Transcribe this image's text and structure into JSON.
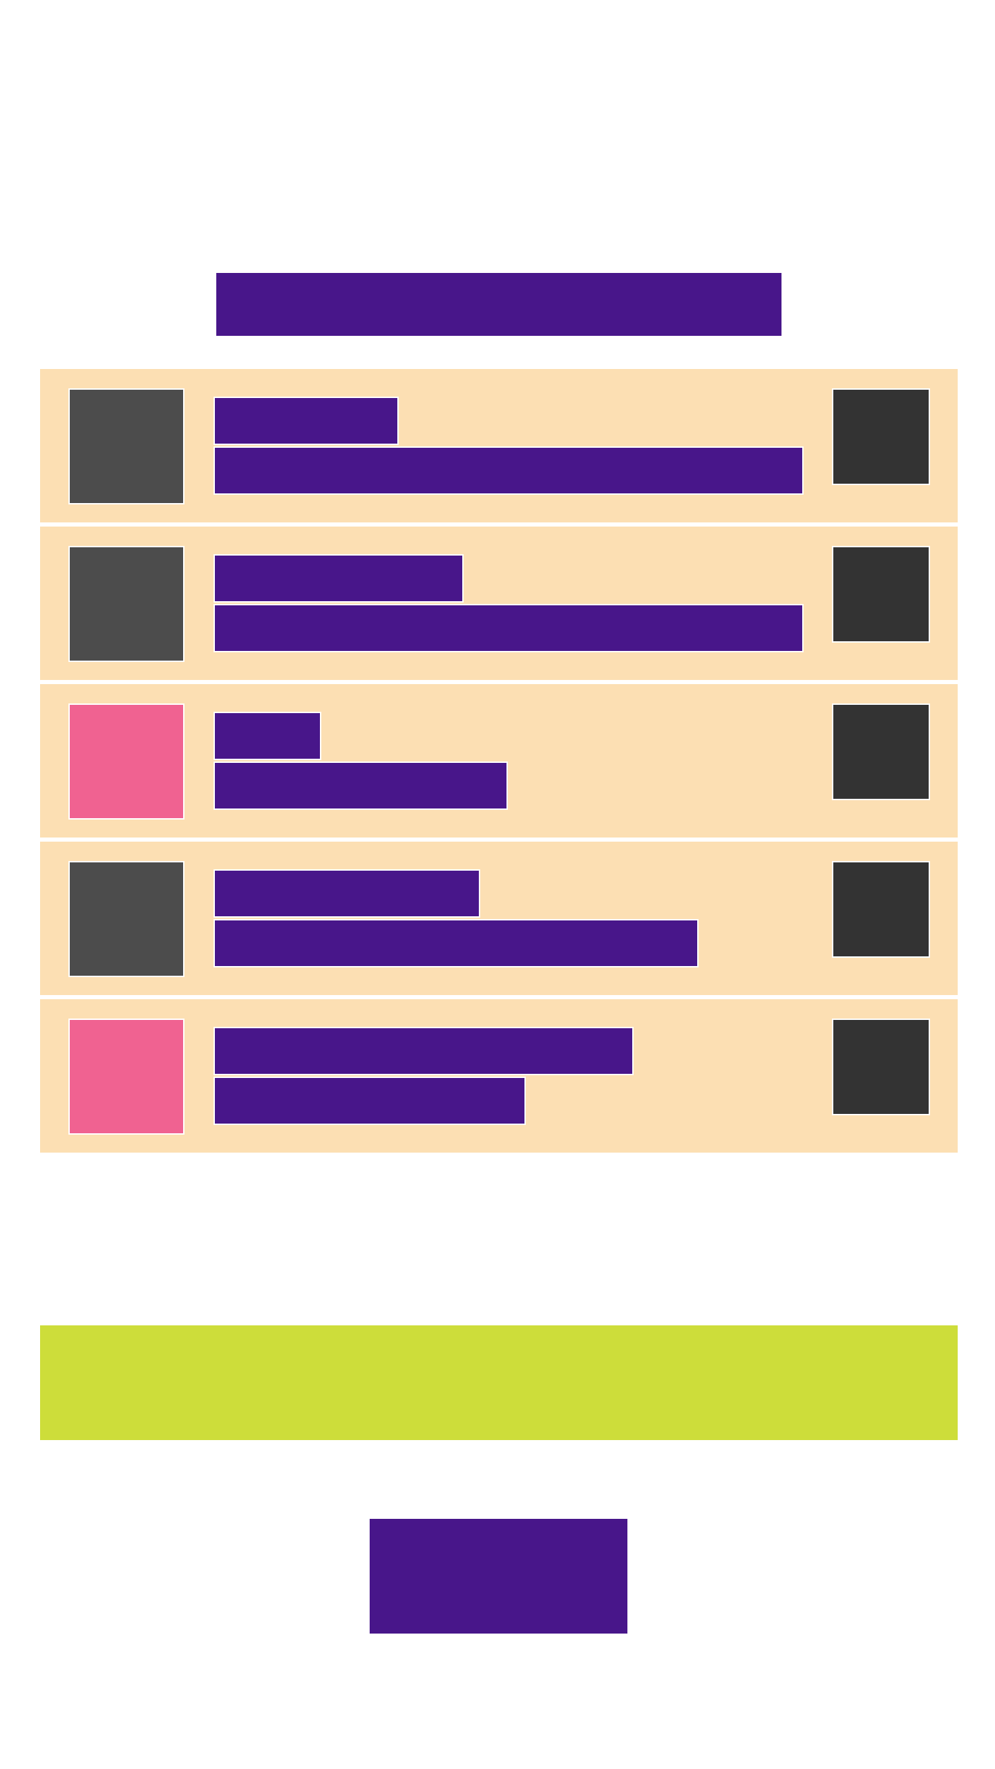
{
  "colors": {
    "background": "#ffffff",
    "accent_purple": "#48168a",
    "row_background": "#fcdfb3",
    "thumb_gray": "#4c4c4c",
    "thumb_pink": "#f06291",
    "action_dark": "#333333",
    "banner_lime": "#cddd3a"
  },
  "list": {
    "items": [
      {
        "thumb_color": "thumb_gray"
      },
      {
        "thumb_color": "thumb_gray"
      },
      {
        "thumb_color": "thumb_pink"
      },
      {
        "thumb_color": "thumb_gray"
      },
      {
        "thumb_color": "thumb_pink"
      }
    ]
  }
}
